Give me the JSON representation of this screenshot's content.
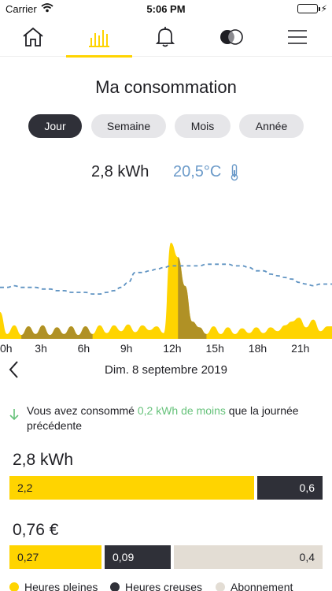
{
  "status_bar": {
    "carrier": "Carrier",
    "time": "5:06 PM"
  },
  "nav": {
    "items": [
      {
        "icon": "home-icon"
      },
      {
        "icon": "consumption-chart-icon",
        "active": true
      },
      {
        "icon": "bell-icon"
      },
      {
        "icon": "compare-circles-icon"
      },
      {
        "icon": "menu-icon"
      }
    ]
  },
  "page_title": "Ma consommation",
  "period_tabs": [
    {
      "label": "Jour",
      "active": true
    },
    {
      "label": "Semaine"
    },
    {
      "label": "Mois"
    },
    {
      "label": "Année"
    }
  ],
  "summary": {
    "energy": "2,8 kWh",
    "temperature": "20,5°C"
  },
  "chart_data": {
    "type": "area",
    "x_ticks": [
      "0h",
      "3h",
      "6h",
      "9h",
      "12h",
      "15h",
      "18h",
      "21h"
    ],
    "hours": [
      0,
      0.5,
      1,
      1.5,
      2,
      2.5,
      3,
      3.5,
      4,
      4.5,
      5,
      5.5,
      6,
      6.5,
      7,
      7.5,
      8,
      8.5,
      9,
      9.5,
      10,
      10.5,
      11,
      11.5,
      12,
      12.5,
      13,
      13.5,
      14,
      14.5,
      15,
      15.5,
      16,
      16.5,
      17,
      17.5,
      18,
      18.5,
      19,
      19.5,
      20,
      20.5,
      21,
      21.5,
      22,
      22.5,
      23
    ],
    "consumption_series": [
      0.28,
      0.05,
      0.14,
      0.04,
      0.13,
      0.05,
      0.14,
      0.04,
      0.12,
      0.05,
      0.13,
      0.04,
      0.13,
      0.05,
      0.14,
      0.06,
      0.14,
      0.08,
      0.15,
      0.07,
      0.14,
      0.09,
      0.13,
      0.06,
      1.0,
      0.85,
      0.55,
      0.18,
      0.12,
      0.05,
      0.13,
      0.05,
      0.12,
      0.05,
      0.11,
      0.06,
      0.12,
      0.06,
      0.12,
      0.08,
      0.14,
      0.18,
      0.22,
      0.12,
      0.2,
      0.08,
      0.13
    ],
    "offpeak_hours_range": [
      [
        1.5,
        6.5
      ],
      [
        12.5,
        14.5
      ]
    ],
    "temperature_series": [
      0.73,
      0.73,
      0.74,
      0.73,
      0.73,
      0.73,
      0.72,
      0.72,
      0.71,
      0.71,
      0.7,
      0.7,
      0.7,
      0.69,
      0.69,
      0.7,
      0.71,
      0.73,
      0.76,
      0.82,
      0.82,
      0.83,
      0.84,
      0.85,
      0.86,
      0.86,
      0.86,
      0.86,
      0.86,
      0.87,
      0.87,
      0.87,
      0.87,
      0.86,
      0.86,
      0.85,
      0.83,
      0.83,
      0.81,
      0.8,
      0.79,
      0.78,
      0.76,
      0.75,
      0.74,
      0.75,
      0.75
    ],
    "series_colors": {
      "peak": "#ffd400",
      "offpeak": "#b09125",
      "temperature": "#5f93c2"
    }
  },
  "date_nav": {
    "date": "Dim. 8 septembre 2019"
  },
  "comparison": {
    "prefix": "Vous avez consommé ",
    "highlight": "0,2 kWh de moins",
    "suffix": " que la journée précédente"
  },
  "energy": {
    "total": "2,8 kWh",
    "peak_value": "2,2",
    "offpeak_value": "0,6",
    "peak_share": 0.786
  },
  "cost": {
    "total": "0,76 €",
    "peak_value": "0,27",
    "offpeak_value": "0,09",
    "subscription_value": "0,4",
    "shares": [
      0.355,
      0.118,
      0.527
    ]
  },
  "legend": [
    {
      "label": "Heures pleines",
      "color": "#ffd400"
    },
    {
      "label": "Heures creuses",
      "color": "#2f3038"
    },
    {
      "label": "Abonnement",
      "color": "#e3ddd4"
    }
  ],
  "colors": {
    "accent": "#ffd400",
    "dark": "#2f3038",
    "temperature": "#6b9ac9",
    "positive": "#66c27a"
  }
}
